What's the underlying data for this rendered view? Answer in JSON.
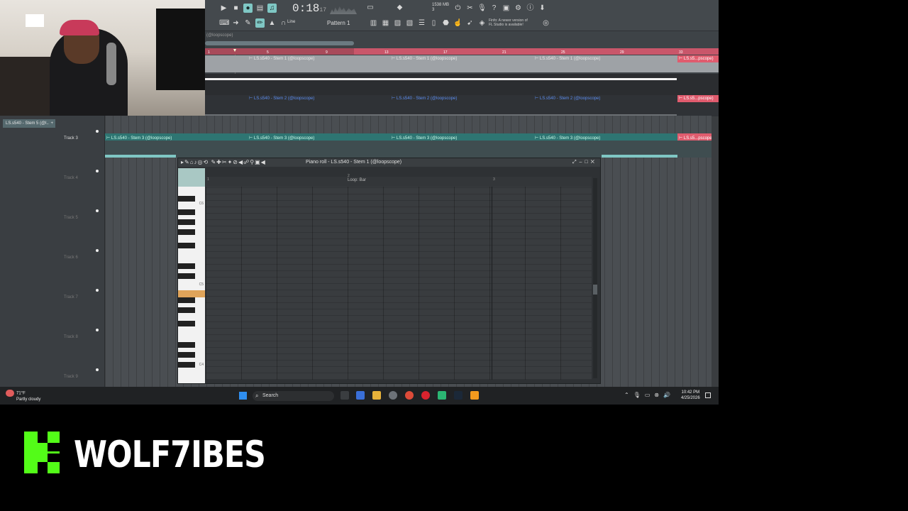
{
  "toolbar": {
    "time": "0:18",
    "time_small": "17",
    "memory": "1538 MB",
    "memory_cpu": "3",
    "tempo_val": "18",
    "pattern": "Pattern 1",
    "snap": "Line",
    "hint_line1": "Finfo: A newer version of",
    "hint_line2": "FL Studio is available!"
  },
  "playlist": {
    "title": "(@loopscope)",
    "ruler_labels": [
      "1",
      "5",
      "9",
      "13",
      "17",
      "21",
      "25",
      "29",
      "33"
    ],
    "clips": {
      "stem1": "LS.s540 - Stem 1 (@loopscope)",
      "stem2": "LS.s540 - Stem 2 (@loopscope)",
      "stem3": "LS.s540 - Stem 3 (@loopscope)",
      "end_clip": "LS.s5...pscope)"
    }
  },
  "sidebar": {
    "selected_pattern": "LS.s540 - Stem 5 (@l..",
    "tracks": [
      "Track 3",
      "Track 4",
      "Track 5",
      "Track 6",
      "Track 7",
      "Track 8",
      "Track 9"
    ]
  },
  "piano_roll": {
    "title": "Piano roll - LS.s540 - Stem 1 (@loopscope)",
    "loop_bar": "Loop: Bar",
    "key_c6": "C6",
    "key_c5": "C5",
    "key_c4": "C4",
    "bar_2": "2",
    "bar_3": "3"
  },
  "taskbar": {
    "temp": "71°F",
    "weather": "Partly cloudy",
    "search": "Search",
    "time": "10:42 PM",
    "date": "4/25/2026"
  },
  "brand": {
    "name": "WOLF7IBES"
  },
  "colors": {
    "accent_teal": "#7fc7c4",
    "clip_pink": "#e05c6e",
    "kick_green": "#53fc18"
  }
}
